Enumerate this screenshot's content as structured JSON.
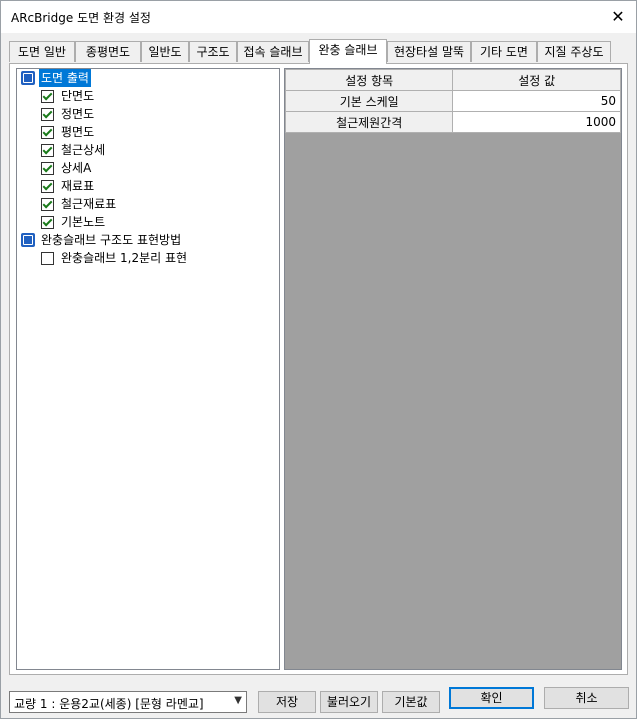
{
  "window": {
    "title": "ARcBridge 도면 환경 설정",
    "close_glyph": "✕"
  },
  "tabs": [
    {
      "label": "도면 일반",
      "active": false
    },
    {
      "label": "종평면도",
      "active": false
    },
    {
      "label": "일반도",
      "active": false
    },
    {
      "label": "구조도",
      "active": false
    },
    {
      "label": "접속 슬래브",
      "active": false
    },
    {
      "label": "완충 슬래브",
      "active": true
    },
    {
      "label": "현장타설 말뚝",
      "active": false
    },
    {
      "label": "기타 도면",
      "active": false
    },
    {
      "label": "지질 주상도",
      "active": false
    }
  ],
  "tree": {
    "groups": [
      {
        "label": "도면 출력",
        "icon": "settings-node-icon",
        "selected": true,
        "items": [
          {
            "label": "단면도",
            "checked": true
          },
          {
            "label": "정면도",
            "checked": true
          },
          {
            "label": "평면도",
            "checked": true
          },
          {
            "label": "철근상세",
            "checked": true
          },
          {
            "label": "상세A",
            "checked": true
          },
          {
            "label": "재료표",
            "checked": true
          },
          {
            "label": "철근재료표",
            "checked": true
          },
          {
            "label": "기본노트",
            "checked": true
          }
        ]
      },
      {
        "label": "완충슬래브 구조도 표현방법",
        "icon": "settings-node-icon",
        "selected": false,
        "items": [
          {
            "label": "완충슬래브 1,2분리 표현",
            "checked": false
          }
        ]
      }
    ]
  },
  "grid": {
    "headers": [
      "설정 항목",
      "설정 값"
    ],
    "rows": [
      {
        "key": "기본 스케일",
        "value": "50"
      },
      {
        "key": "철근제원간격",
        "value": "1000"
      }
    ]
  },
  "bottom": {
    "bridge_select": "교량 1 : 운용2교(세종) [문형 라멘교]",
    "save": "저장",
    "load": "불러오기",
    "default": "기본값",
    "ok": "확인",
    "cancel": "취소"
  },
  "colors": {
    "selection": "#0078d7",
    "check": "#1a7a1a",
    "grid_empty": "#a0a0a0"
  }
}
